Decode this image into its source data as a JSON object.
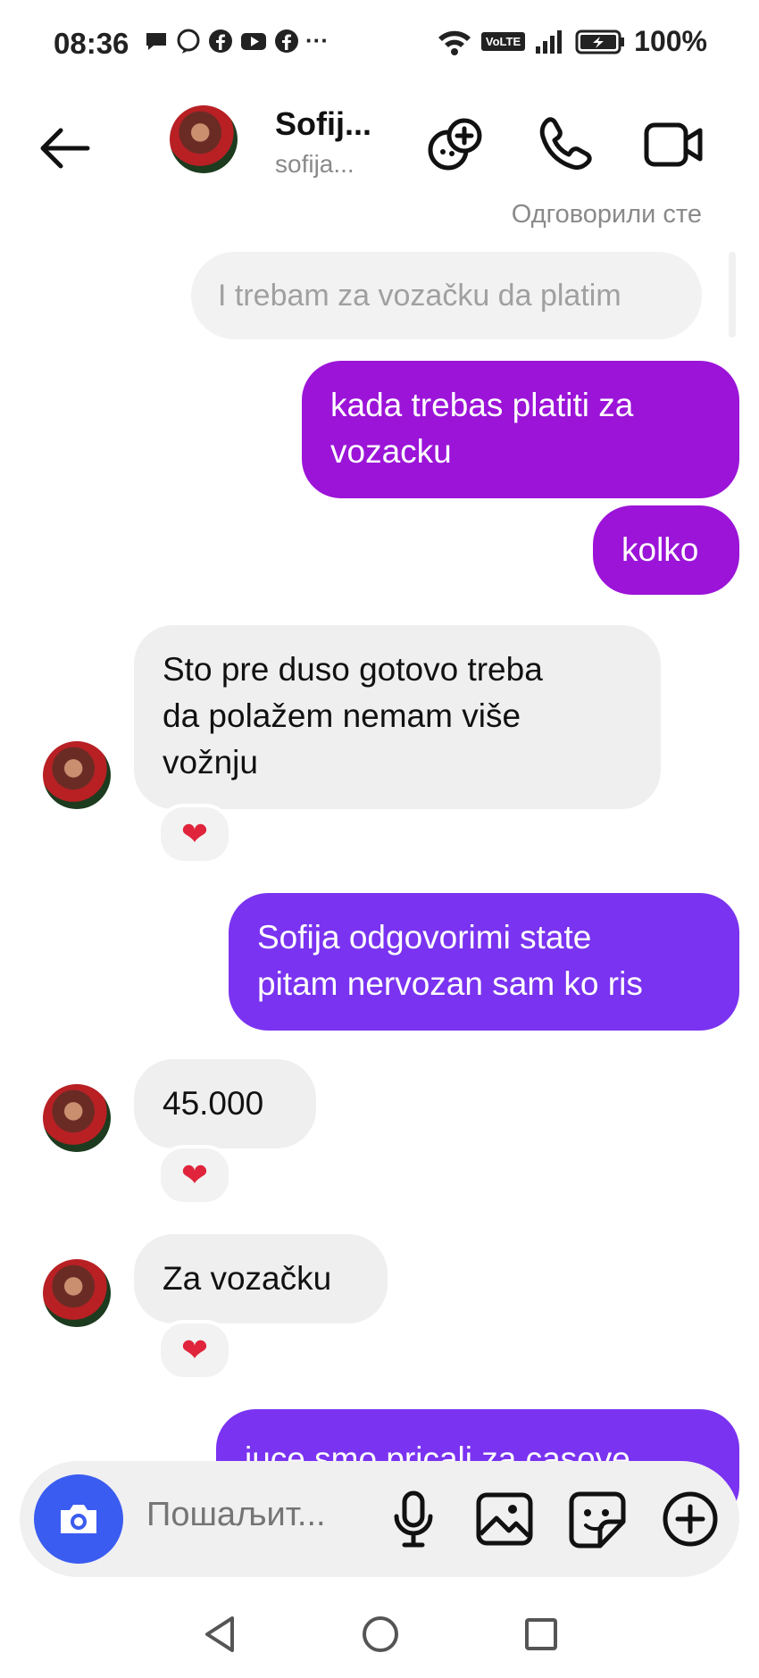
{
  "status_bar": {
    "time": "08:36",
    "battery": "100%",
    "network": "VoLTE",
    "overflow": "···"
  },
  "header": {
    "name": "Sofij...",
    "username": "sofija..."
  },
  "reply_context": {
    "note": "Одговорили сте",
    "quoted_text": "I trebam za vozačku da platim"
  },
  "messages": [
    {
      "direction": "outgoing",
      "lines": [
        "kada trebas platiti za",
        "vozacku"
      ]
    },
    {
      "direction": "outgoing",
      "lines": [
        "kolko"
      ]
    },
    {
      "direction": "incoming",
      "lines": [
        "Sto pre duso gotovo treba",
        "da polažem nemam više",
        "vožnju"
      ],
      "reaction": "❤"
    },
    {
      "direction": "outgoing",
      "lines": [
        "Sofija odgovorimi state",
        "pitam nervozan sam ko ris"
      ]
    },
    {
      "direction": "incoming",
      "lines": [
        "45.000"
      ],
      "reaction": "❤"
    },
    {
      "direction": "incoming",
      "lines": [
        "Za vozačku"
      ],
      "reaction": "❤"
    },
    {
      "direction": "outgoing",
      "lines": [
        "juce smo pricali za casove"
      ]
    }
  ],
  "composer": {
    "placeholder": "Пошаљит..."
  },
  "colors": {
    "outgoing_magenta": "#9b14d8",
    "outgoing_violet": "#7a33f0",
    "camera_blue": "#3b5cf0",
    "heart": "#e0243b"
  }
}
